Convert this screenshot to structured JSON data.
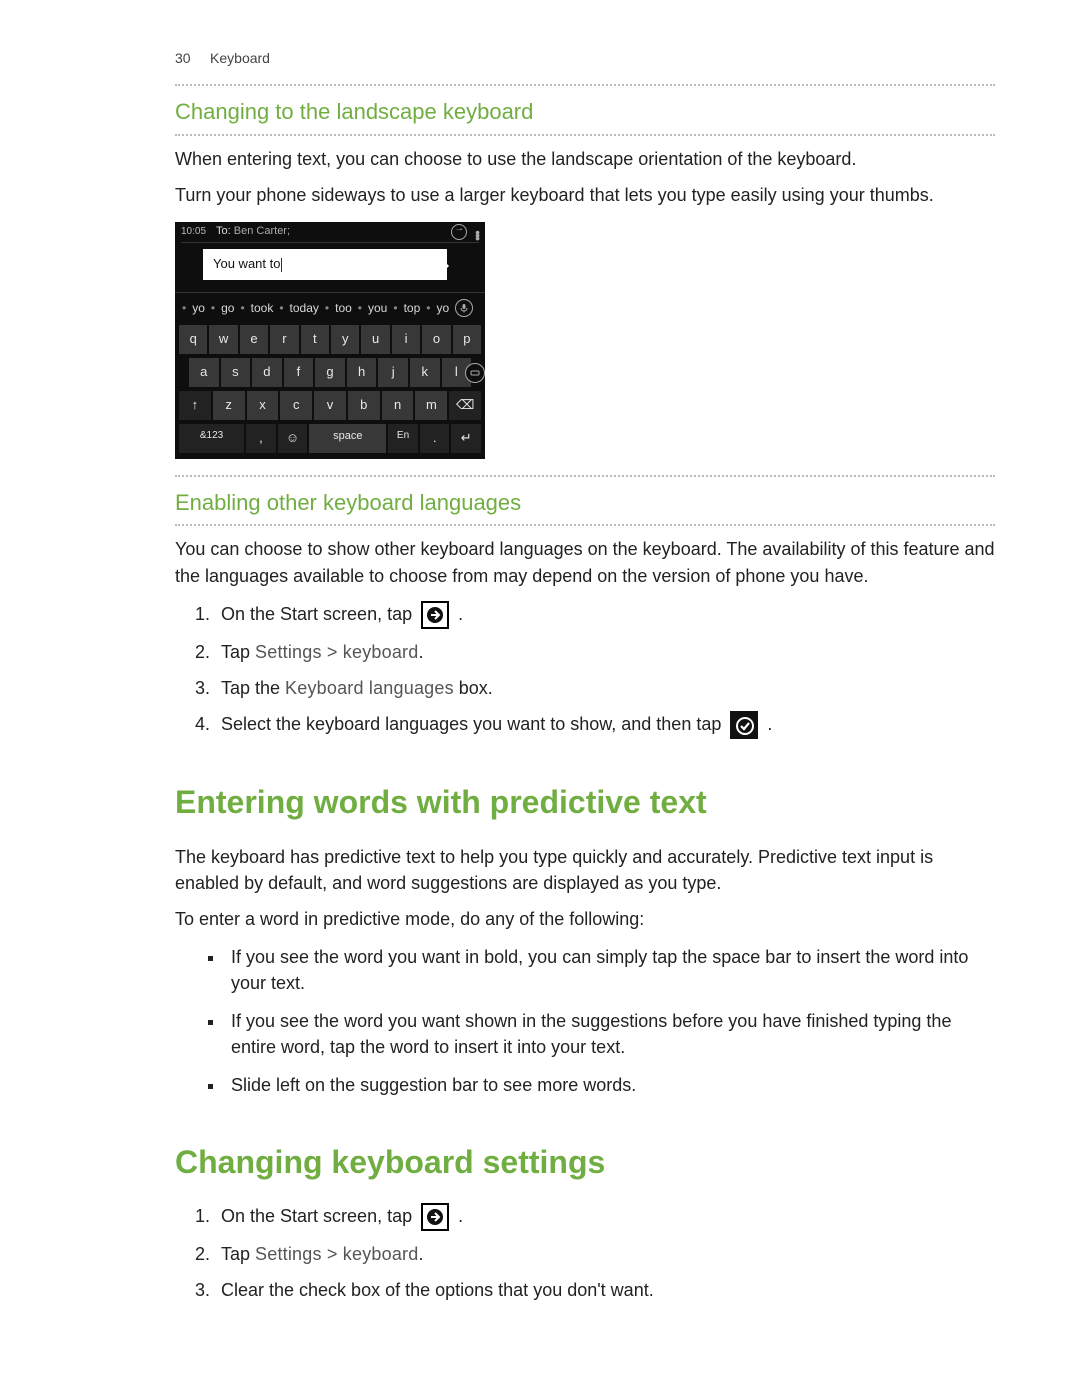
{
  "header": {
    "pageNumber": "30",
    "section": "Keyboard"
  },
  "s1": {
    "title": "Changing to the landscape keyboard",
    "p1": "When entering text, you can choose to use the landscape orientation of the keyboard.",
    "p2": "Turn your phone sideways to use a larger keyboard that lets you type easily using your thumbs."
  },
  "phone": {
    "clock": "10:05",
    "toLabel": "To:",
    "toValue": "Ben Carter;",
    "bubble": "You want to",
    "suggestions": [
      "yo",
      "go",
      "took",
      "today",
      "too",
      "you",
      "top",
      "yo"
    ],
    "row1": [
      "q",
      "w",
      "e",
      "r",
      "t",
      "y",
      "u",
      "i",
      "o",
      "p"
    ],
    "row2": [
      "a",
      "s",
      "d",
      "f",
      "g",
      "h",
      "j",
      "k",
      "l"
    ],
    "row3": {
      "shift": "↑",
      "keys": [
        "z",
        "x",
        "c",
        "v",
        "b",
        "n",
        "m"
      ],
      "back": "⌫"
    },
    "row4": {
      "sym": "&123",
      "comma": ",",
      "emoji": "☺",
      "space": "space",
      "lang": "En",
      "period": ".",
      "enter": "↵"
    }
  },
  "s2": {
    "title": "Enabling other keyboard languages",
    "p1": "You can choose to show other keyboard languages on the keyboard. The availability of this feature and the languages available to choose from may depend on the version of phone you have.",
    "steps": {
      "1a": "On the Start screen, tap ",
      "1b": " .",
      "2a": "Tap ",
      "2b": "Settings > keyboard",
      "2c": ".",
      "3a": "Tap the  ",
      "3b": "Keyboard languages",
      "3c": " box.",
      "4a": "Select the keyboard languages you want to show, and then tap ",
      "4b": "."
    }
  },
  "s3": {
    "title": "Entering words with predictive text",
    "p1": "The keyboard has predictive text to help you type quickly and accurately. Predictive text input is enabled by default, and word suggestions are displayed as you type.",
    "p2": "To enter a word in predictive mode, do any of the following:",
    "bullets": [
      "If you see the word you want in bold, you can simply tap the space bar to insert the word into your text.",
      "If you see the word you want shown in the suggestions before you have finished typing the entire word, tap the word to insert it into your text.",
      "Slide left on the suggestion bar to see more words."
    ]
  },
  "s4": {
    "title": "Changing keyboard settings",
    "steps": {
      "1a": "On the Start screen, tap ",
      "1b": " .",
      "2a": "Tap ",
      "2b": "Settings > keyboard",
      "2c": ".",
      "3": "Clear the check box of the options that you don't want."
    }
  }
}
